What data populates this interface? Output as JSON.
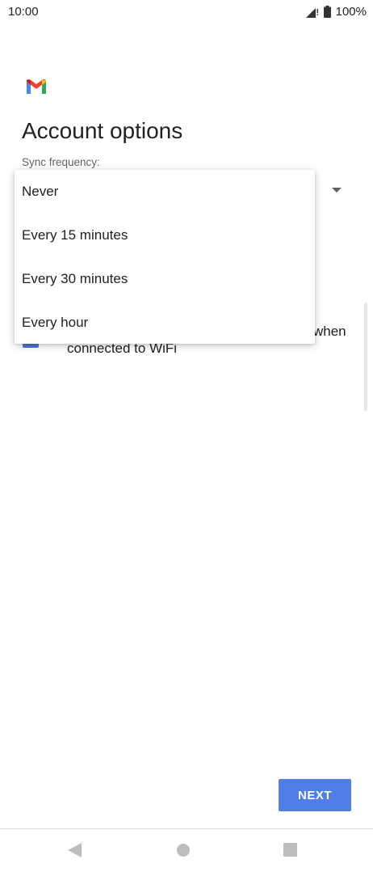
{
  "status_bar": {
    "time": "10:00",
    "battery": "100%"
  },
  "header": {
    "title": "Account options"
  },
  "sync": {
    "label": "Sync frequency:",
    "options": [
      "Never",
      "Every 15 minutes",
      "Every 30 minutes",
      "Every hour"
    ]
  },
  "checkbox": {
    "label_line1": "when",
    "label_line2": "connected to WiFi",
    "checked": true
  },
  "actions": {
    "next_label": "NEXT"
  },
  "colors": {
    "accent": "#4f7fe6",
    "checkbox": "#4a76d4"
  },
  "icons": [
    "signal-icon",
    "battery-icon",
    "gmail-logo",
    "dropdown-arrow-icon",
    "back-icon",
    "home-icon",
    "recent-apps-icon"
  ]
}
